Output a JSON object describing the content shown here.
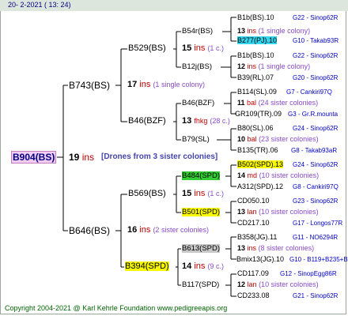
{
  "header": {
    "date": "20- 2-2021 ( 13: 24)"
  },
  "footer": {
    "copyright": "Copyright 2004-2021 @ Karl Kehrle Foundation www.pedigreeapis.org"
  },
  "root": {
    "name": "B904(BS)",
    "count": "19",
    "unit": "ins",
    "note": "[Drones from 3 sister colonies]"
  },
  "gen2": {
    "upper": {
      "name": "B743(BS)",
      "count": "17",
      "unit": "ins",
      "note": "(1 single colony)"
    },
    "lower": {
      "name": "B646(BS)",
      "count": "16",
      "unit": "ins",
      "note": "(2 sister colonies)"
    }
  },
  "gen3": {
    "b529": {
      "name": "B529(BS)",
      "count": "15",
      "unit": "ins",
      "note": "(1 c.)"
    },
    "b46": {
      "name": "B46(BZF)",
      "count": "13",
      "unit": "fhkg",
      "note": "(28 c.)"
    },
    "b569": {
      "name": "B569(BS)",
      "count": "15",
      "unit": "ins",
      "note": "(1 c.)"
    },
    "b394": {
      "name": "B394(SPD)",
      "count": "14",
      "unit": "ins",
      "note": "(9 c.)"
    }
  },
  "gen4": {
    "b54r": {
      "name": "B54r(BS)",
      "count": "13",
      "unit": "ins",
      "note": "(1 single colony)"
    },
    "b12j": {
      "name": "B12j(BS)",
      "count": "12",
      "unit": "ins",
      "note": "(1 single colony)"
    },
    "b46bzf": {
      "name": "B46(BZF)",
      "count": "11",
      "unit": "bal",
      "note": "(24 sister colonies)"
    },
    "b79sl": {
      "name": "B79(SL)",
      "count": "10",
      "unit": "bal",
      "note": "(23 sister colonies)"
    },
    "b484": {
      "name": "B484(SPD)",
      "count": "14",
      "unit": "md",
      "note": "(10 sister colonies)"
    },
    "b501": {
      "name": "B501(SPD)",
      "count": "13",
      "unit": "lan",
      "note": "(10 sister colonies)"
    },
    "b613": {
      "name": "B613(SPD)",
      "count": "13",
      "unit": "ins",
      "note": "(8 sister colonies)"
    },
    "b117": {
      "name": "B117(SPD)",
      "count": "12",
      "unit": "lan",
      "note": "(10 sister colonies)"
    }
  },
  "gen5": [
    {
      "name": "B1b(BS).10",
      "colony": "G22 - Sinop62R"
    },
    {
      "name": "B277(PJ).10",
      "colony": "G10 - Takab93R"
    },
    {
      "name": "B1b(BS).10",
      "colony": "G22 - Sinop62R"
    },
    {
      "name": "B39(RL).07",
      "colony": "G20 - Sinop62R"
    },
    {
      "name": "B114(SL).09",
      "colony": "G7 - Cankiri97Q"
    },
    {
      "name": "GR109(TR).09",
      "colony": "G3 - Gr.R.mounta"
    },
    {
      "name": "B80(SL).06",
      "colony": "G24 - Sinop62R"
    },
    {
      "name": "B135(TR).06",
      "colony": "G8 - Takab93aR"
    },
    {
      "name": "B502(SPD).13",
      "colony": "G24 - Sinop62R"
    },
    {
      "name": "A312(SPD).12",
      "colony": "G8 - Cankiri97Q"
    },
    {
      "name": "CD050.10",
      "colony": "G23 - Sinop62R"
    },
    {
      "name": "CD217.10",
      "colony": "G17 - Longos77R"
    },
    {
      "name": "B358(JG).11",
      "colony": "G11 - NO6294R"
    },
    {
      "name": "Bmix13(JG).10",
      "colony": "G10 - B119+B235+B"
    },
    {
      "name": "CD117.09",
      "colony": "G12 - SinopEgg86R"
    },
    {
      "name": "CD233.08",
      "colony": "G21 - Sinop62R"
    }
  ]
}
